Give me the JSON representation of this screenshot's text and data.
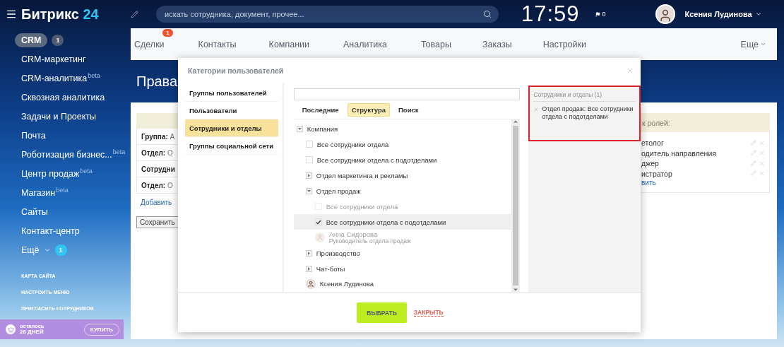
{
  "header": {
    "logo": {
      "name": "Битрикс",
      "number": "24"
    },
    "search": {
      "placeholder": "искать сотрудника, документ, прочее..."
    },
    "clock": "17:59",
    "flag_count": "0",
    "user": {
      "name": "Ксения Лудинова"
    }
  },
  "sidebar": {
    "items": [
      {
        "label": "CRM",
        "badge": "1",
        "selected": true
      },
      {
        "label": "CRM-маркетинг",
        "selected": false
      },
      {
        "label": "CRM-аналитика",
        "tag": "beta",
        "selected": false
      },
      {
        "label": "Сквозная аналитика",
        "selected": false
      },
      {
        "label": "Задачи и Проекты",
        "selected": false
      },
      {
        "label": "Почта",
        "selected": false
      },
      {
        "label": "Роботизация бизнес...",
        "tag": "beta",
        "selected": false
      },
      {
        "label": "Центр продаж",
        "tag": "beta",
        "selected": false
      },
      {
        "label": "Магазин",
        "tag": "beta",
        "selected": false
      },
      {
        "label": "Сайты",
        "selected": false
      },
      {
        "label": "Контакт-центр",
        "selected": false
      },
      {
        "label": "Ещё",
        "badge": "1",
        "caret": true,
        "selected": false
      }
    ],
    "links": [
      "КАРТА САЙТА",
      "НАСТРОИТЬ МЕНЮ",
      "ПРИГЛАСИТЬ СОТРУДНИКОВ"
    ],
    "promo": {
      "line_1": "осталось",
      "line_2": "26 ДНЕЙ",
      "button": "КУПИТЬ"
    }
  },
  "tabs": [
    {
      "label": "Сделки",
      "badge": "1"
    },
    {
      "label": "Контакты"
    },
    {
      "label": "Компании"
    },
    {
      "label": "Аналитика"
    },
    {
      "label": "Товары"
    },
    {
      "label": "Заказы"
    },
    {
      "label": "Настройки"
    }
  ],
  "more_tab": "Еще",
  "page": {
    "title": "Права",
    "table": {
      "rows": [
        {
          "label": "Группа:",
          "value": "А"
        },
        {
          "label": "Отдел:",
          "value": "О"
        },
        {
          "label": "Сотрудни"
        },
        {
          "label": "Отдел:",
          "value": "О"
        }
      ]
    },
    "add_link": "Добавить",
    "save_button": "Сохранить",
    "roles": {
      "title": "к ролей:",
      "items": [
        "етолог",
        "одитель направления",
        "джер",
        "истратор"
      ],
      "add_link": "вить"
    }
  },
  "dialog": {
    "title": "Категории пользователей",
    "categories": [
      {
        "label": "Группы пользователей",
        "selected": false
      },
      {
        "label": "Пользователи",
        "selected": false
      },
      {
        "label": "Сотрудники и отделы",
        "selected": true
      },
      {
        "label": "Группы социальной сети",
        "selected": false
      }
    ],
    "tabs": [
      {
        "label": "Последние",
        "selected": false
      },
      {
        "label": "Структура",
        "selected": true
      },
      {
        "label": "Поиск",
        "selected": false
      }
    ],
    "tree": [
      {
        "kind": "folder",
        "label": "Компания",
        "expanded": true,
        "children": [
          {
            "kind": "checkbox",
            "label": "Все сотрудники отдела",
            "checked": false,
            "disabled": false
          },
          {
            "kind": "checkbox",
            "label": "Все сотрудники отдела с подотделами",
            "checked": false,
            "disabled": false
          },
          {
            "kind": "folder",
            "label": "Отдел маркетинга и рекламы",
            "expanded": false
          },
          {
            "kind": "folder",
            "label": "Отдел продаж",
            "expanded": true,
            "children": [
              {
                "kind": "checkbox",
                "label": "Все сотрудники отдела",
                "checked": false,
                "disabled": true
              },
              {
                "kind": "checkbox",
                "label": "Все сотрудники отдела с подотделами",
                "checked": true,
                "disabled": false
              },
              {
                "kind": "person",
                "label": "Анна Сидорова",
                "role": "Руководитель отдела продаж",
                "disabled": true
              }
            ]
          },
          {
            "kind": "folder",
            "label": "Производство",
            "expanded": false
          },
          {
            "kind": "folder",
            "label": "Чат-боты",
            "expanded": false
          },
          {
            "kind": "person",
            "label": "Ксения Лудинова",
            "disabled": false
          }
        ]
      }
    ],
    "selection": {
      "title": "Сотрудники и отделы (1)",
      "items": [
        "Отдел продаж: Все сотрудники отдела с подотделами"
      ]
    },
    "confirm_button": "ВЫБРАТЬ",
    "cancel_link": "ЗАКРЫТЬ"
  }
}
